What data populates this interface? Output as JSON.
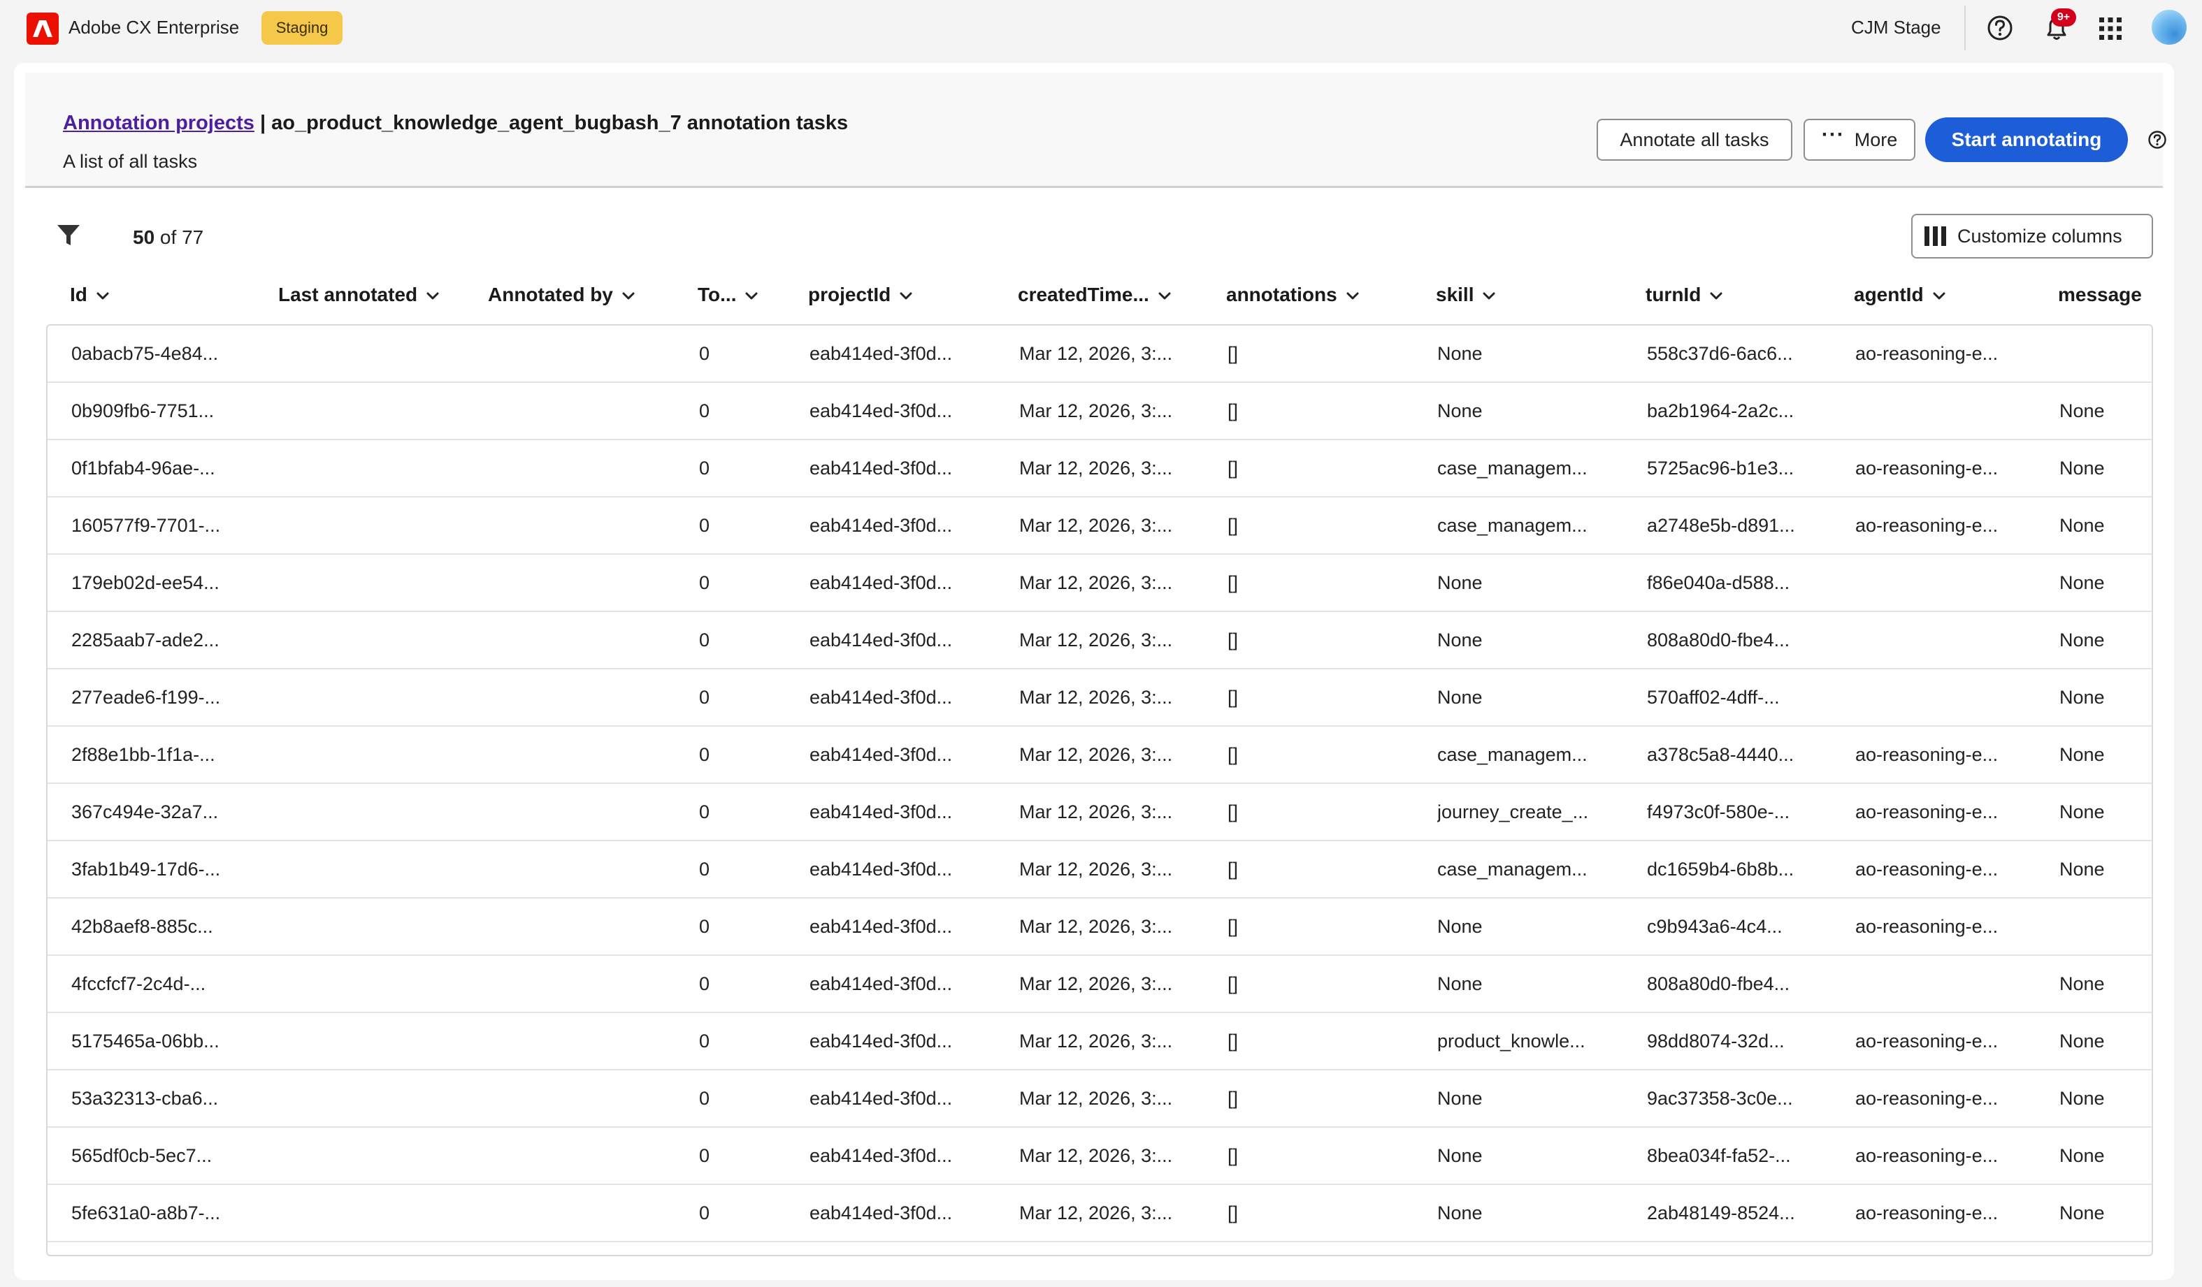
{
  "app": {
    "title": "Adobe CX Enterprise",
    "environment": "Staging",
    "org": "CJM Stage",
    "notifications_badge": "9+",
    "brand_color": "#eb1000",
    "accent_color": "#1d5ed8"
  },
  "header": {
    "breadcrumb_link": "Annotation projects",
    "separator": " | ",
    "title": "ao_product_knowledge_agent_bugbash_7 annotation tasks",
    "subtitle": "A list of all tasks",
    "annotate_all_label": "Annotate all tasks",
    "more_label": "More",
    "start_label": "Start annotating"
  },
  "toolbar": {
    "count_shown": "50",
    "count_suffix": " of 77",
    "customize_label": "Customize columns"
  },
  "table": {
    "columns": [
      "Id",
      "Last annotated",
      "Annotated by",
      "To...",
      "projectId",
      "createdTime...",
      "annotations",
      "skill",
      "turnId",
      "agentId",
      "message"
    ],
    "rows": [
      [
        "0abacb75-4e84...",
        "",
        "",
        "0",
        "eab414ed-3f0d...",
        "Mar 12, 2026, 3:...",
        "[]",
        "None",
        "558c37d6-6ac6...",
        "ao-reasoning-e...",
        ""
      ],
      [
        "0b909fb6-7751...",
        "",
        "",
        "0",
        "eab414ed-3f0d...",
        "Mar 12, 2026, 3:...",
        "[]",
        "None",
        "ba2b1964-2a2c...",
        "",
        "None"
      ],
      [
        "0f1bfab4-96ae-...",
        "",
        "",
        "0",
        "eab414ed-3f0d...",
        "Mar 12, 2026, 3:...",
        "[]",
        "case_managem...",
        "5725ac96-b1e3...",
        "ao-reasoning-e...",
        "None"
      ],
      [
        "160577f9-7701-...",
        "",
        "",
        "0",
        "eab414ed-3f0d...",
        "Mar 12, 2026, 3:...",
        "[]",
        "case_managem...",
        "a2748e5b-d891...",
        "ao-reasoning-e...",
        "None"
      ],
      [
        "179eb02d-ee54...",
        "",
        "",
        "0",
        "eab414ed-3f0d...",
        "Mar 12, 2026, 3:...",
        "[]",
        "None",
        "f86e040a-d588...",
        "",
        "None"
      ],
      [
        "2285aab7-ade2...",
        "",
        "",
        "0",
        "eab414ed-3f0d...",
        "Mar 12, 2026, 3:...",
        "[]",
        "None",
        "808a80d0-fbe4...",
        "",
        "None"
      ],
      [
        "277eade6-f199-...",
        "",
        "",
        "0",
        "eab414ed-3f0d...",
        "Mar 12, 2026, 3:...",
        "[]",
        "None",
        "570aff02-4dff-...",
        "",
        "None"
      ],
      [
        "2f88e1bb-1f1a-...",
        "",
        "",
        "0",
        "eab414ed-3f0d...",
        "Mar 12, 2026, 3:...",
        "[]",
        "case_managem...",
        "a378c5a8-4440...",
        "ao-reasoning-e...",
        "None"
      ],
      [
        "367c494e-32a7...",
        "",
        "",
        "0",
        "eab414ed-3f0d...",
        "Mar 12, 2026, 3:...",
        "[]",
        "journey_create_...",
        "f4973c0f-580e-...",
        "ao-reasoning-e...",
        "None"
      ],
      [
        "3fab1b49-17d6-...",
        "",
        "",
        "0",
        "eab414ed-3f0d...",
        "Mar 12, 2026, 3:...",
        "[]",
        "case_managem...",
        "dc1659b4-6b8b...",
        "ao-reasoning-e...",
        "None"
      ],
      [
        "42b8aef8-885c...",
        "",
        "",
        "0",
        "eab414ed-3f0d...",
        "Mar 12, 2026, 3:...",
        "[]",
        "None",
        "c9b943a6-4c4...",
        "ao-reasoning-e...",
        ""
      ],
      [
        "4fccfcf7-2c4d-...",
        "",
        "",
        "0",
        "eab414ed-3f0d...",
        "Mar 12, 2026, 3:...",
        "[]",
        "None",
        "808a80d0-fbe4...",
        "",
        "None"
      ],
      [
        "5175465a-06bb...",
        "",
        "",
        "0",
        "eab414ed-3f0d...",
        "Mar 12, 2026, 3:...",
        "[]",
        "product_knowle...",
        "98dd8074-32d...",
        "ao-reasoning-e...",
        "None"
      ],
      [
        "53a32313-cba6...",
        "",
        "",
        "0",
        "eab414ed-3f0d...",
        "Mar 12, 2026, 3:...",
        "[]",
        "None",
        "9ac37358-3c0e...",
        "ao-reasoning-e...",
        "None"
      ],
      [
        "565df0cb-5ec7...",
        "",
        "",
        "0",
        "eab414ed-3f0d...",
        "Mar 12, 2026, 3:...",
        "[]",
        "None",
        "8bea034f-fa52-...",
        "ao-reasoning-e...",
        "None"
      ],
      [
        "5fe631a0-a8b7-...",
        "",
        "",
        "0",
        "eab414ed-3f0d...",
        "Mar 12, 2026, 3:...",
        "[]",
        "None",
        "2ab48149-8524...",
        "ao-reasoning-e...",
        "None"
      ]
    ]
  }
}
